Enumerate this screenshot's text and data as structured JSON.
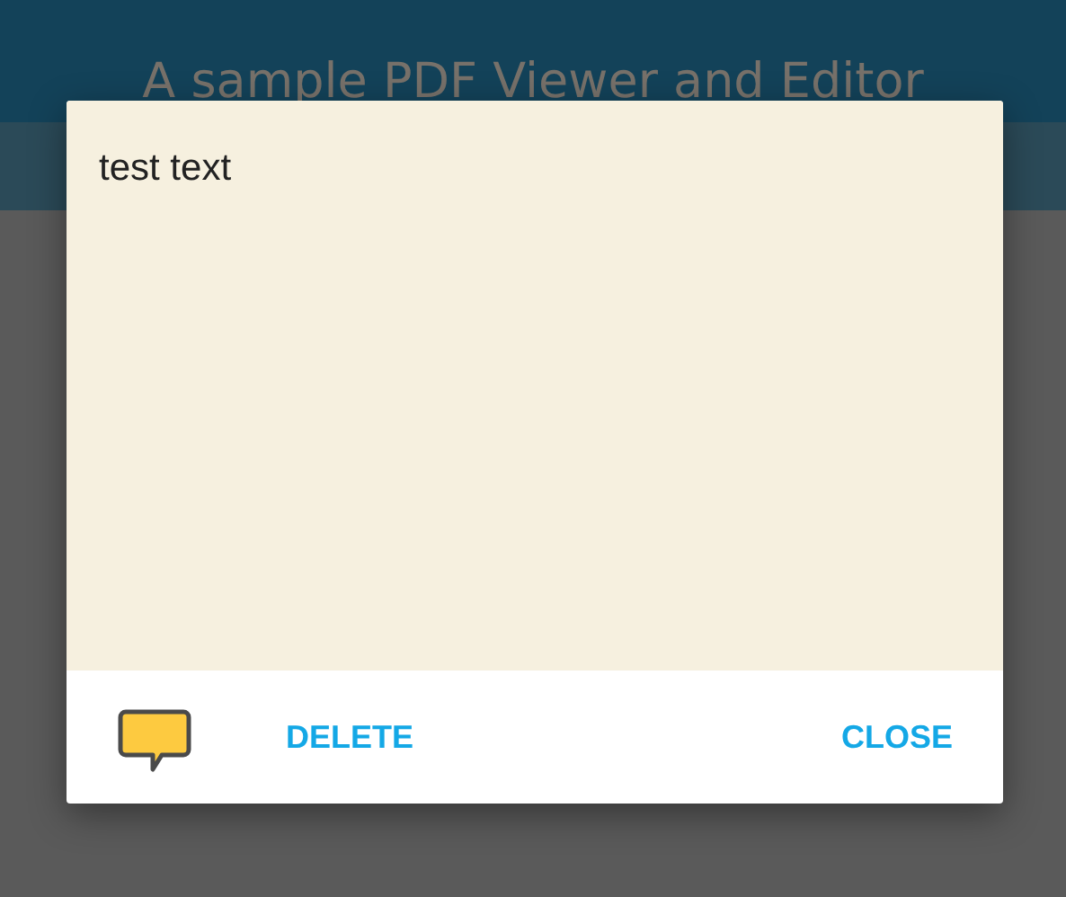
{
  "header": {
    "subtitle": "A sample PDF Viewer and Editor"
  },
  "note_dialog": {
    "text": "test text",
    "buttons": [
      {
        "kind": "delete",
        "label": "DELETE"
      },
      {
        "kind": "close",
        "label": "CLOSE"
      }
    ]
  }
}
